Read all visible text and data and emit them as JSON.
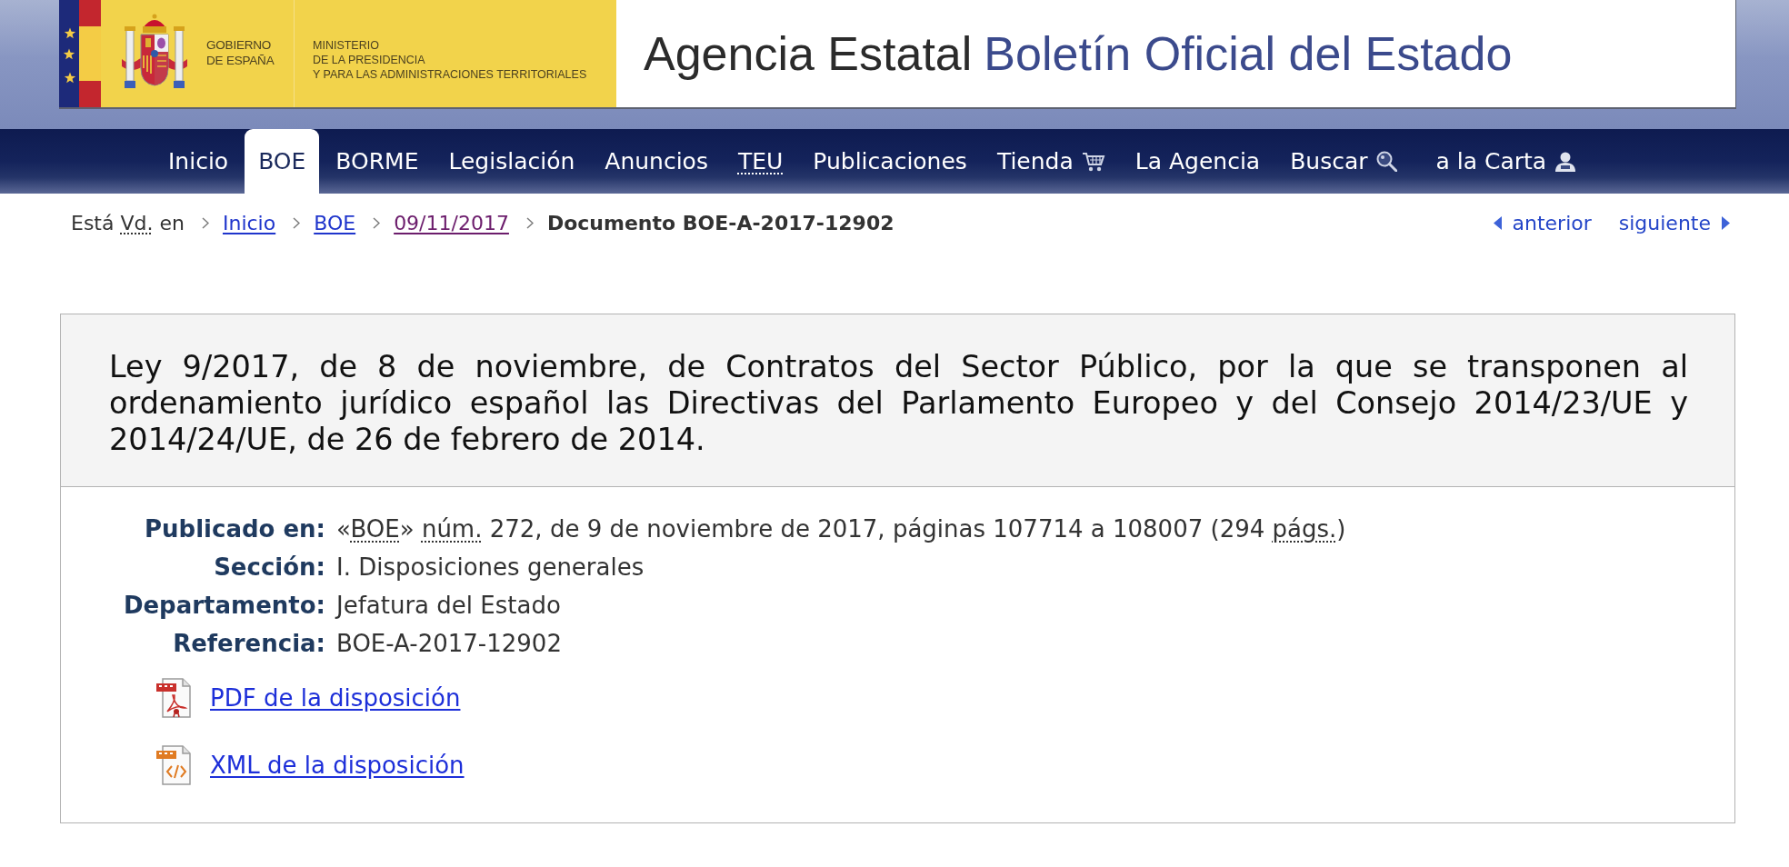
{
  "header": {
    "government_lines": [
      "GOBIERNO",
      "DE ESPAÑA"
    ],
    "ministry_lines": [
      "MINISTERIO",
      "DE LA PRESIDENCIA",
      "Y PARA LAS ADMINISTRACIONES TERRITORIALES"
    ],
    "agency_prefix": "Agencia Estatal",
    "agency_name": "Boletín Oficial del Estado"
  },
  "nav": [
    {
      "label": "Inicio",
      "kind": "link",
      "selected": false
    },
    {
      "label": "BOE",
      "kind": "link",
      "selected": true
    },
    {
      "label": "BORME",
      "kind": "link",
      "selected": false
    },
    {
      "label": "Legislación",
      "kind": "link",
      "selected": false
    },
    {
      "label": "Anuncios",
      "kind": "link",
      "selected": false
    },
    {
      "label": "TEU",
      "kind": "abbreviation",
      "selected": false
    },
    {
      "label": "Publicaciones",
      "kind": "link",
      "selected": false
    },
    {
      "label": "Tienda",
      "kind": "store",
      "selected": false
    },
    {
      "label": "La Agencia",
      "kind": "link",
      "selected": false
    },
    {
      "label": "Buscar",
      "kind": "search",
      "selected": false
    },
    {
      "label": "a la Carta",
      "kind": "personal",
      "selected": false
    }
  ],
  "breadcrumb": {
    "intro": [
      {
        "text": "Está ",
        "abbr": false
      },
      {
        "text": "Vd.",
        "abbr": true
      },
      {
        "text": " en",
        "abbr": false
      }
    ],
    "links": [
      {
        "label": "Inicio",
        "visited": false
      },
      {
        "label": "BOE",
        "visited": false
      },
      {
        "label": "09/11/2017",
        "visited": true
      }
    ],
    "current": "Documento BOE-A-2017-12902"
  },
  "pager": {
    "previous": "anterior",
    "next": "siguiente"
  },
  "document": {
    "title": "Ley 9/2017, de 8 de noviembre, de Contratos del Sector Público, por la que se transponen al ordenamiento jurídico español las Directivas del Parlamento Europeo y del Consejo 2014/23/UE y 2014/24/UE, de 26 de febrero de 2014.",
    "fields": [
      {
        "label": "Publicado en:",
        "value": [
          {
            "text": "«",
            "abbr": false
          },
          {
            "text": "BOE",
            "abbr": true
          },
          {
            "text": "» ",
            "abbr": false
          },
          {
            "text": "núm.",
            "abbr": true
          },
          {
            "text": " 272, de 9 de noviembre de 2017, páginas 107714 a 108007 (294 ",
            "abbr": false
          },
          {
            "text": "págs.",
            "abbr": true
          },
          {
            "text": ")",
            "abbr": false
          }
        ]
      },
      {
        "label": "Sección:",
        "value": [
          {
            "text": "I. Disposiciones generales",
            "abbr": false
          }
        ]
      },
      {
        "label": "Departamento:",
        "value": [
          {
            "text": "Jefatura del Estado",
            "abbr": false
          }
        ]
      },
      {
        "label": "Referencia:",
        "value": [
          {
            "text": "BOE-A-2017-12902",
            "abbr": false
          }
        ]
      }
    ],
    "downloads": [
      {
        "label": "PDF de la disposición",
        "kind": "pdf"
      },
      {
        "label": "XML de la disposición",
        "kind": "xml"
      }
    ]
  }
}
